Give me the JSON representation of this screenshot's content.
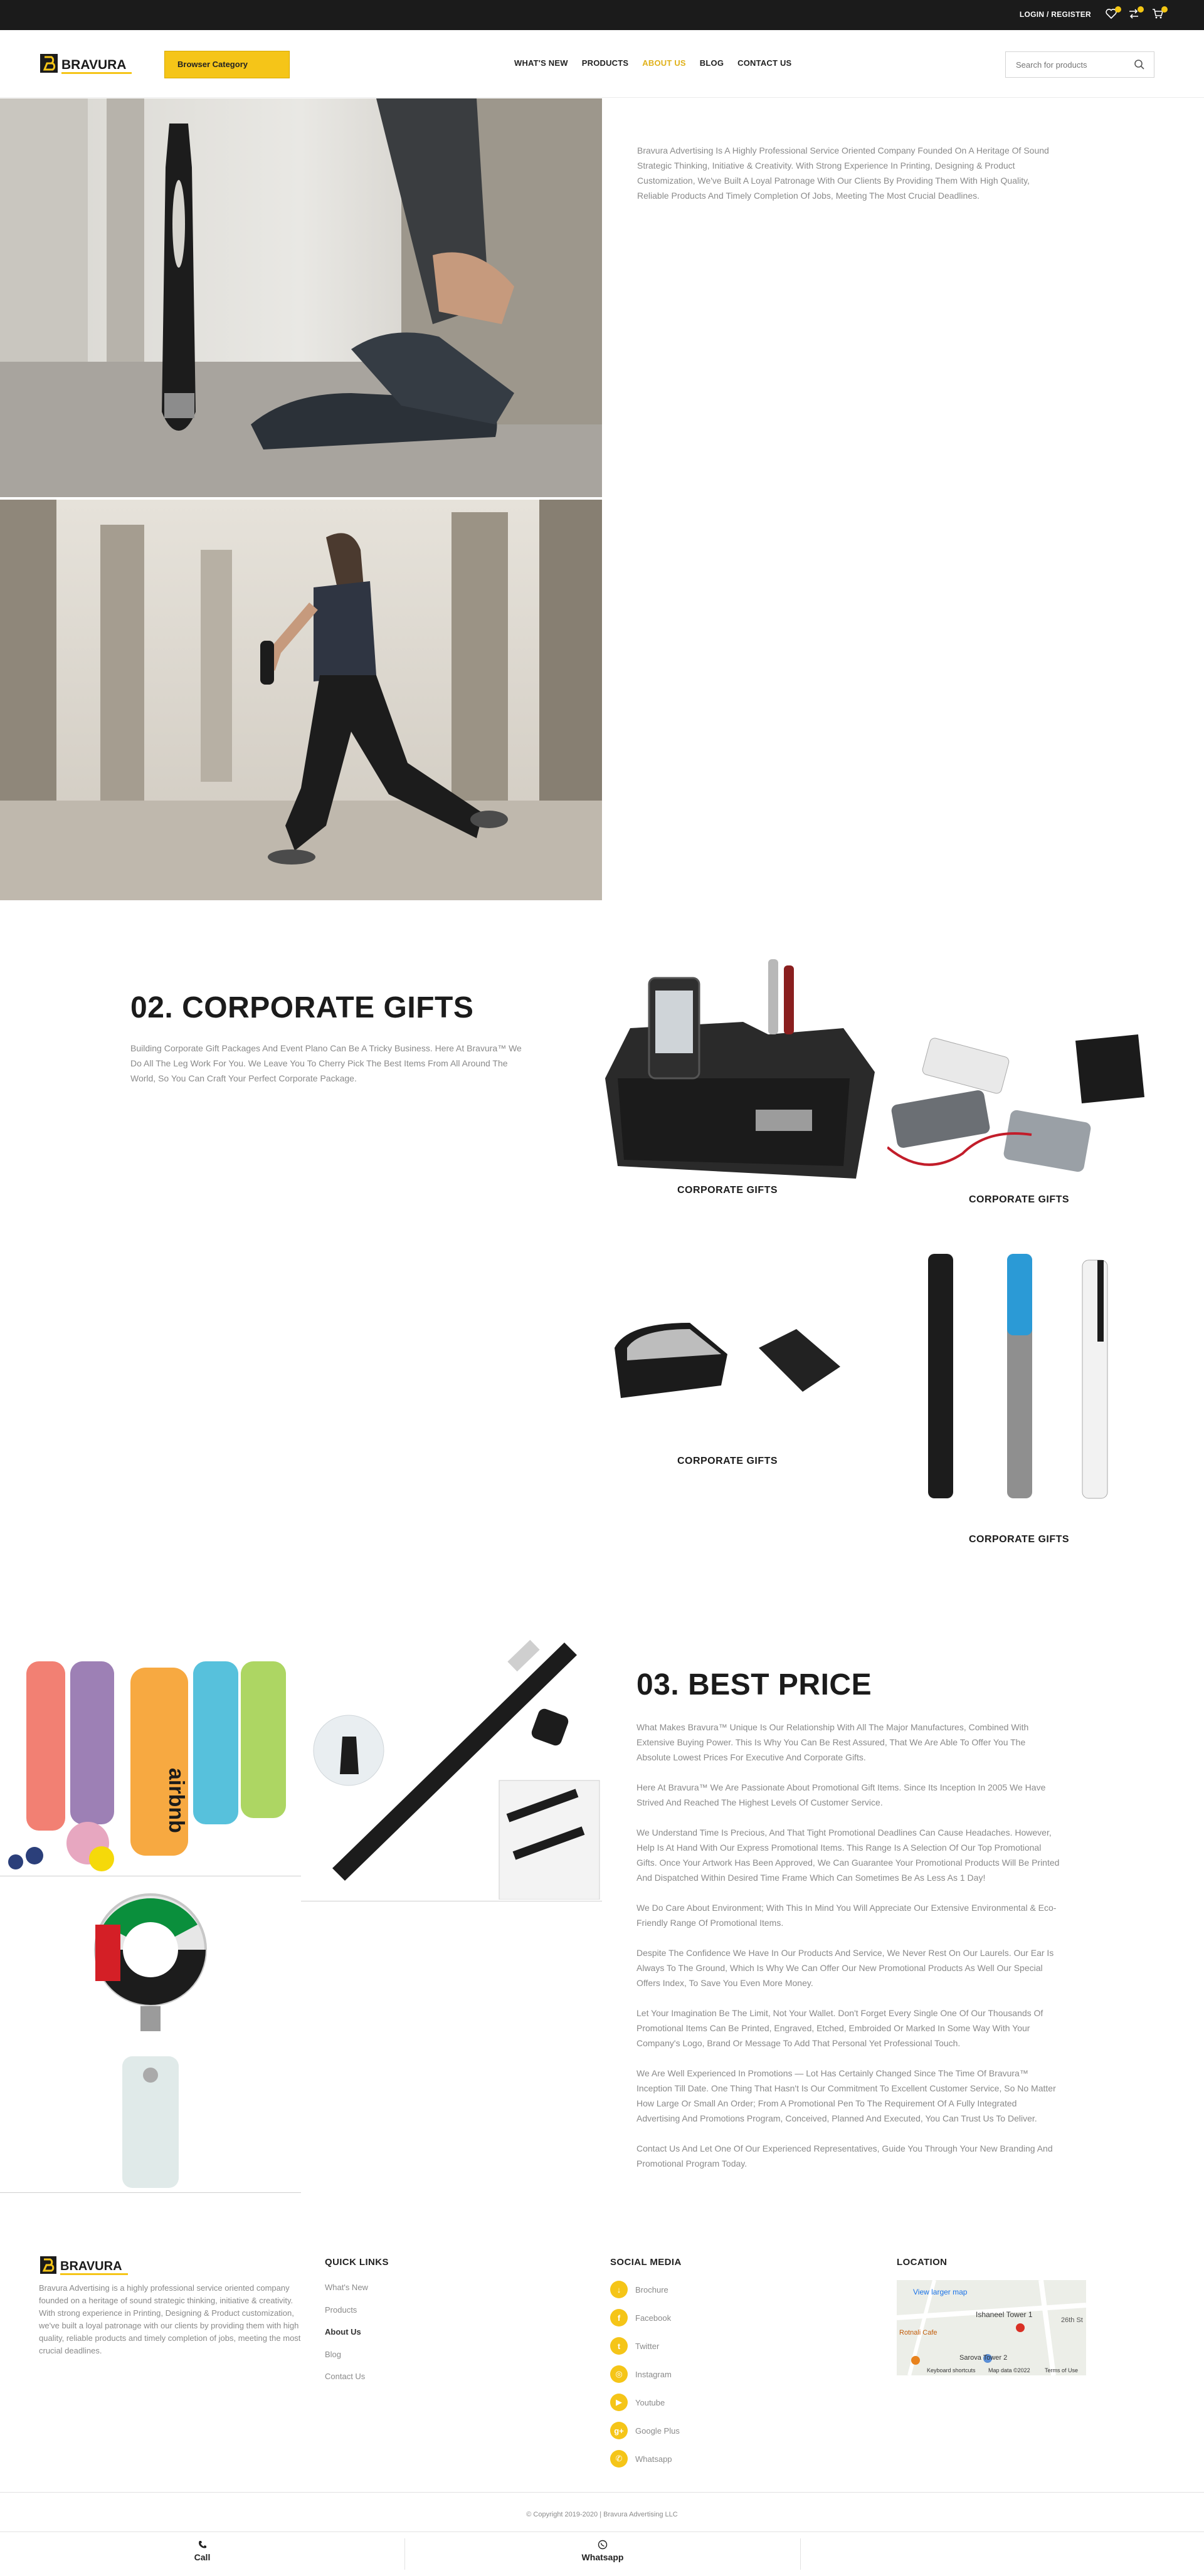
{
  "topbar": {
    "login_label": "LOGIN / REGISTER"
  },
  "header": {
    "logo_text": "BRAVURA",
    "browse_label": "Browser Category",
    "nav": [
      "WHAT'S NEW",
      "PRODUCTS",
      "ABOUT US",
      "BLOG",
      "CONTACT US"
    ],
    "active_nav": "ABOUT US",
    "search_placeholder": "Search for products"
  },
  "intro": {
    "text": "Bravura Advertising Is A Highly Professional Service Oriented Company Founded On A Heritage Of Sound Strategic Thinking, Initiative & Creativity. With Strong Experience In Printing, Designing & Product Customization, We've Built A Loyal Patronage With Our Clients By Providing Them With High Quality, Reliable Products And Timely Completion Of Jobs, Meeting The Most Crucial Deadlines."
  },
  "corporate": {
    "title": "02. CORPORATE GIFTS",
    "text": "Building Corporate Gift Packages And Event Plano Can Be A Tricky Business. Here At Bravura™ We Do All The Leg Work For You. We Leave You To Cherry Pick The Best Items From All Around The World, So You Can Craft Your Perfect Corporate Package.",
    "labels": [
      "CORPORATE GIFTS",
      "CORPORATE GIFTS",
      "CORPORATE GIFTS",
      "CORPORATE GIFTS"
    ]
  },
  "best_price": {
    "title": "03. BEST PRICE",
    "paragraphs": [
      "What Makes Bravura™ Unique Is Our Relationship With All The Major Manufactures, Combined With Extensive Buying Power. This Is Why You Can Be Rest Assured, That We Are Able To Offer You The Absolute Lowest Prices For Executive And Corporate Gifts.",
      "Here At Bravura™ We Are Passionate About Promotional Gift Items. Since Its Inception In 2005 We Have Strived And Reached The Highest Levels Of Customer Service.",
      "We Understand Time Is Precious, And That Tight Promotional Deadlines Can Cause Headaches. However, Help Is At Hand With Our Express Promotional Items. This Range Is A Selection Of Our Top Promotional Gifts. Once Your Artwork Has Been Approved, We Can Guarantee Your Promotional Products Will Be Printed And Dispatched Within Desired Time Frame Which Can Sometimes Be As Less As 1 Day!",
      "We Do Care About Environment; With This In Mind You Will Appreciate Our Extensive Environmental & Eco-Friendly Range Of Promotional Items.",
      "Despite The Confidence We Have In Our Products And Service, We Never Rest On Our Laurels. Our Ear Is Always To The Ground, Which Is Why We Can Offer Our New Promotional Products As Well Our Special Offers Index, To Save You Even More Money.",
      "Let Your Imagination Be The Limit, Not Your Wallet. Don't Forget Every Single One Of Our Thousands Of Promotional Items Can Be Printed, Engraved, Etched, Embroided Or Marked In Some Way With Your Company's Logo, Brand Or Message To Add That Personal Yet Professional Touch.",
      "We Are Well Experienced In Promotions — Lot Has Certainly Changed Since The Time Of Bravura™ Inception Till Date. One Thing That Hasn't Is Our Commitment To Excellent Customer Service, So No Matter How Large Or Small An Order; From A Promotional Pen To The Requirement Of A Fully Integrated Advertising And Promotions Program, Conceived, Planned And Executed, You Can Trust Us To Deliver.",
      "Contact Us And Let One Of Our Experienced Representatives, Guide You Through Your New Branding And Promotional Program Today."
    ],
    "bottle_brand": "airbnb"
  },
  "footer": {
    "about": "Bravura Advertising is a highly professional service oriented company founded on a heritage of sound strategic thinking, initiative & creativity. With strong experience in Printing, Designing & Product customization, we've built a loyal patronage with our clients by providing them with high quality, reliable products and timely completion of jobs, meeting the most crucial deadlines.",
    "quick_links_title": "QUICK LINKS",
    "quick_links": [
      "What's New",
      "Products",
      "About Us",
      "Blog",
      "Contact Us"
    ],
    "social_title": "SOCIAL MEDIA",
    "social": [
      "Brochure",
      "Facebook",
      "Twitter",
      "Instagram",
      "Youtube",
      "Google Plus",
      "Whatsapp"
    ],
    "location_title": "LOCATION",
    "map": {
      "view_larger": "View larger map",
      "tower1": "Ishaneel Tower 1",
      "tower2": "Sarova Tower 2",
      "cafe": "Rotnali Cafe",
      "road": "26th St",
      "footer_a": "Keyboard shortcuts",
      "footer_b": "Map data ©2022",
      "footer_c": "Terms of Use"
    },
    "copyright": "© Copyright 2019-2020 | Bravura Advertising LLC"
  },
  "bottombar": {
    "call": "Call",
    "whatsapp": "Whatsapp"
  },
  "colors": {
    "accent": "#f5c518",
    "dark": "#1b1b1b",
    "muted": "#8a8a8a"
  }
}
